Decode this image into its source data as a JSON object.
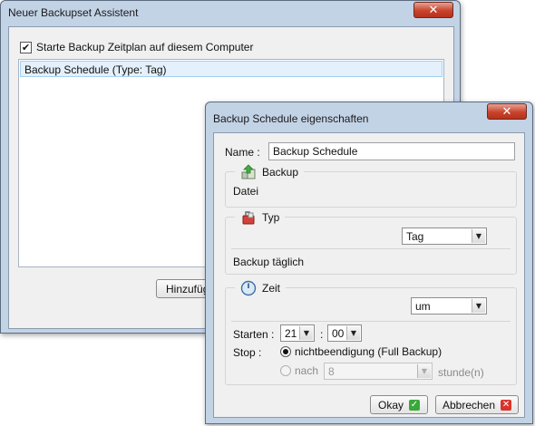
{
  "main_window": {
    "title": "Neuer Backupset Assistent",
    "close_label": "✕",
    "checkbox_label": "Starte Backup Zeitplan auf diesem Computer",
    "checkbox_checked": true,
    "schedules": [
      "Backup Schedule (Type: Tag)"
    ],
    "add_button_label": "Hinzufüg"
  },
  "dialog": {
    "title": "Backup Schedule eigenschaften",
    "close_label": "✕",
    "name_label": "Name :",
    "name_value": "Backup Schedule",
    "backup_section": {
      "title": "Backup",
      "value": "Datei",
      "icon": "backup-icon"
    },
    "type_section": {
      "title": "Typ",
      "selected": "Tag",
      "description": "Backup täglich",
      "icon": "type-icon"
    },
    "time_section": {
      "title": "Zeit",
      "icon": "clock-icon",
      "mode_selected": "um",
      "start_label": "Starten :",
      "start_hour": "21",
      "time_separator": ":",
      "start_minute": "00",
      "stop_label": "Stop :",
      "stop_option_never": "nichtbeendigung (Full Backup)",
      "stop_option_after": "nach",
      "stop_after_value": "8",
      "stop_after_unit": "stunde(n)"
    },
    "ok_label": "Okay",
    "cancel_label": "Abbrechen",
    "colors": {
      "ok_icon": "#3aa83a",
      "cancel_icon": "#d9342b",
      "selection": "#e4f0fb"
    }
  }
}
